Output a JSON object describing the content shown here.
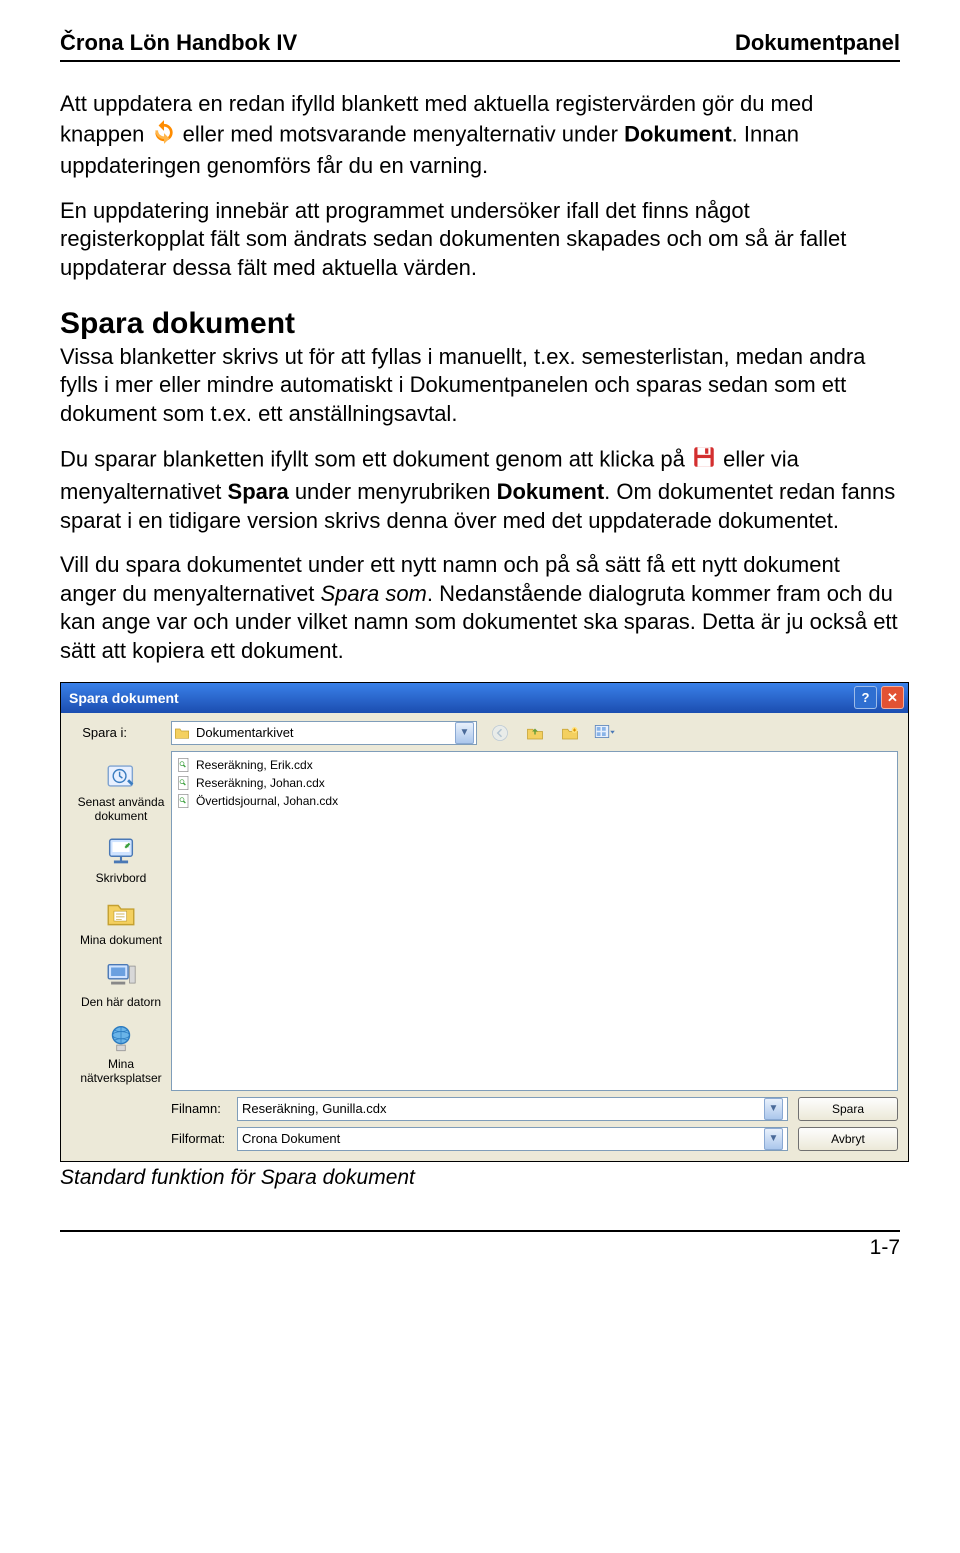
{
  "header": {
    "left": "Črona Lön Handbok IV",
    "right": "Dokumentpanel"
  },
  "paragraphs": {
    "p1a": "Att uppdatera en redan ifylld blankett med aktuella registervärden gör du med knappen ",
    "p1b": " eller med motsvarande menyalternativ under ",
    "p1_dokument": "Dokument",
    "p1c": ". Innan uppdateringen genomförs får du en varning.",
    "p2": "En uppdatering innebär att programmet undersöker ifall det finns något registerkopplat fält som ändrats sedan dokumenten skapades och om så är fallet uppdaterar dessa fält med aktuella värden.",
    "h2": "Spara dokument",
    "p3": "Vissa blanketter skrivs ut för att fyllas i manuellt, t.ex. semesterlistan, medan andra fylls i mer eller mindre automatiskt i Dokumentpanelen och sparas sedan som ett dokument som t.ex. ett anställningsavtal.",
    "p4a": "Du sparar blanketten ifyllt som ett dokument genom att klicka på ",
    "p4b": " eller via menyalternativet ",
    "p4_spara": "Spara",
    "p4c": " under menyrubriken ",
    "p4_dokument": "Dokument",
    "p4d": ". Om dokumentet redan fanns sparat i en tidigare version skrivs denna över med det uppdaterade dokumentet.",
    "p5a": "Vill du spara dokumentet under ett nytt namn och på så sätt få ett nytt dokument anger du menyalternativet ",
    "p5_sparasom": "Spara som",
    "p5b": ". Nedanstående dialogruta kommer fram och du kan ange var och under vilket namn som dokumentet ska sparas. Detta är ju också ett sätt att kopiera ett dokument."
  },
  "dialog": {
    "title": "Spara dokument",
    "savein_label": "Spara i:",
    "savein_value": "Dokumentarkivet",
    "sidebar": [
      "Senast använda dokument",
      "Skrivbord",
      "Mina dokument",
      "Den här datorn",
      "Mina nätverksplatser"
    ],
    "files": [
      "Reseräkning, Erik.cdx",
      "Reseräkning, Johan.cdx",
      "Övertidsjournal, Johan.cdx"
    ],
    "filename_label": "Filnamn:",
    "filename_value": "Reseräkning, Gunilla.cdx",
    "format_label": "Filformat:",
    "format_value": "Crona Dokument",
    "save_button": "Spara",
    "cancel_button": "Avbryt"
  },
  "caption": "Standard funktion för Spara dokument",
  "page_number": "1-7"
}
